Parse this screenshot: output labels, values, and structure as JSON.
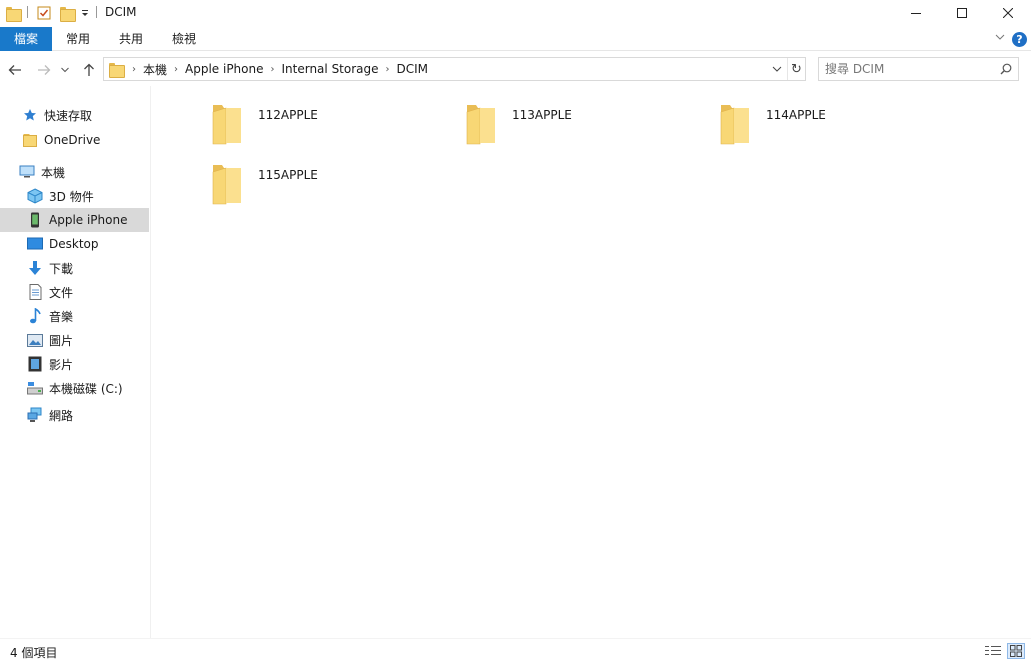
{
  "window": {
    "title": "DCIM",
    "minimize_glyph": "—",
    "maximize_glyph": "☐",
    "close_glyph": "✕"
  },
  "ribbon": {
    "tabs": [
      {
        "label": "檔案",
        "active": true
      },
      {
        "label": "常用"
      },
      {
        "label": "共用"
      },
      {
        "label": "檢視"
      }
    ],
    "help_glyph": "?",
    "collapse_glyph": "⌄"
  },
  "nav": {
    "back_glyph": "←",
    "forward_glyph": "→",
    "recent_glyph": "⌄",
    "up_glyph": "↑"
  },
  "address": {
    "crumbs": [
      "本機",
      "Apple iPhone",
      "Internal Storage",
      "DCIM"
    ],
    "separator": "›",
    "dropdown_glyph": "⌄",
    "refresh_glyph": "↻"
  },
  "search": {
    "placeholder": "搜尋 DCIM"
  },
  "sidebar": {
    "items": [
      {
        "label": "快速存取",
        "icon": "star-icon"
      },
      {
        "label": "OneDrive",
        "icon": "folder-icon"
      },
      {
        "label": "本機",
        "icon": "computer-icon"
      },
      {
        "label": "3D 物件",
        "icon": "cube-icon"
      },
      {
        "label": "Apple iPhone",
        "icon": "phone-icon",
        "selected": true
      },
      {
        "label": "Desktop",
        "icon": "desktop-icon"
      },
      {
        "label": "下載",
        "icon": "download-arrow-icon"
      },
      {
        "label": "文件",
        "icon": "document-icon"
      },
      {
        "label": "音樂",
        "icon": "music-note-icon"
      },
      {
        "label": "圖片",
        "icon": "picture-icon"
      },
      {
        "label": "影片",
        "icon": "film-icon"
      },
      {
        "label": "本機磁碟 (C:)",
        "icon": "drive-icon"
      },
      {
        "label": "網路",
        "icon": "network-icon"
      }
    ]
  },
  "files": [
    {
      "name": "112APPLE",
      "type": "folder"
    },
    {
      "name": "113APPLE",
      "type": "folder"
    },
    {
      "name": "114APPLE",
      "type": "folder"
    },
    {
      "name": "115APPLE",
      "type": "folder"
    }
  ],
  "status": {
    "item_count": "4 個項目"
  },
  "colors": {
    "accent": "#1979ca",
    "folder": "#f8d775",
    "selected_nav": "#d9d9d9"
  }
}
